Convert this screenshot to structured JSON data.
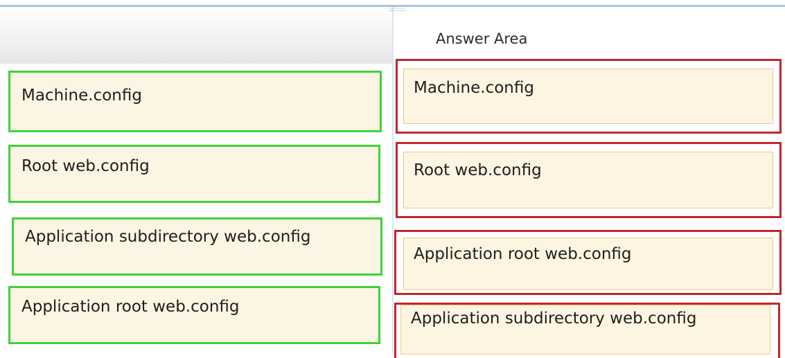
{
  "splitter": {
    "grip": "::::::::"
  },
  "answer_area": {
    "title": "Answer Area",
    "slots": [
      {
        "label": "Machine.config"
      },
      {
        "label": "Root web.config"
      },
      {
        "label": "Application root web.config"
      },
      {
        "label": "Application subdirectory web.config"
      }
    ]
  },
  "source_list": {
    "items": [
      {
        "label": "Machine.config"
      },
      {
        "label": "Root web.config"
      },
      {
        "label": "Application subdirectory web.config"
      },
      {
        "label": "Application root web.config"
      }
    ]
  },
  "colors": {
    "source_border": "#3fd23a",
    "slot_border": "#c0282c",
    "card_fill": "#fdf5e1"
  }
}
